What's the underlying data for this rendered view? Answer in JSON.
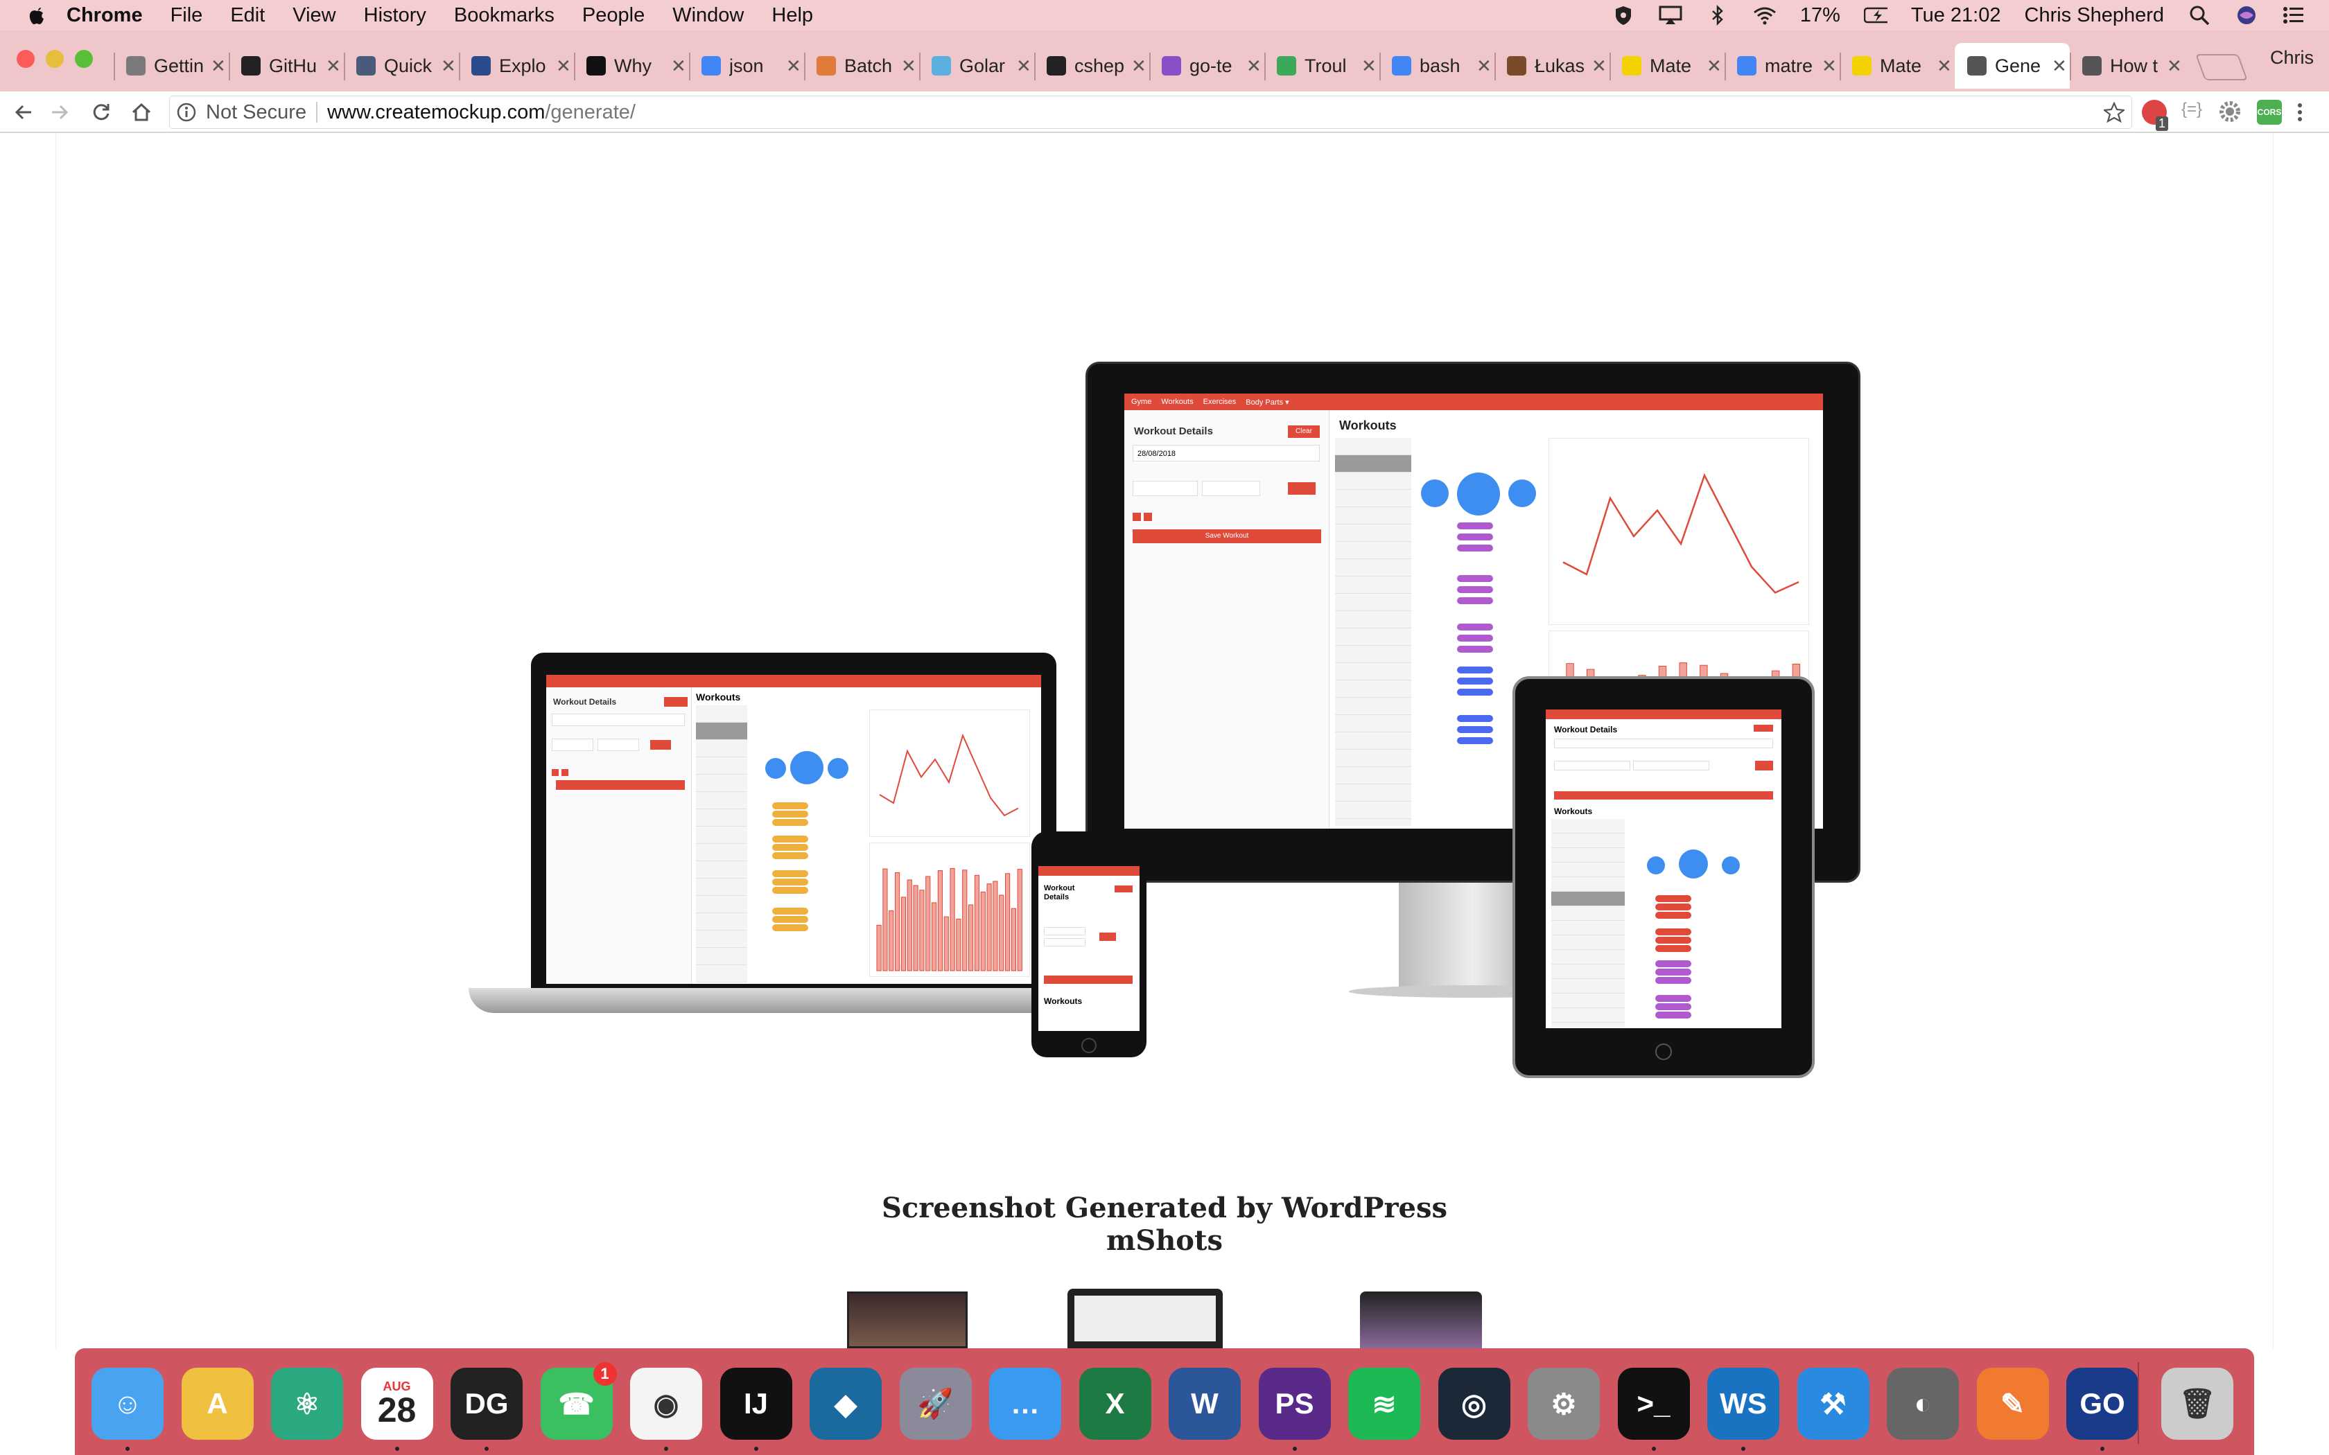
{
  "menubar": {
    "app": "Chrome",
    "items": [
      "File",
      "Edit",
      "View",
      "History",
      "Bookmarks",
      "People",
      "Window",
      "Help"
    ],
    "battery": "17%",
    "clock": "Tue 21:02",
    "user": "Chris Shepherd"
  },
  "tabs": [
    {
      "title": "Gettin",
      "color": "#7a7a7a"
    },
    {
      "title": "GitHu",
      "color": "#222"
    },
    {
      "title": "Quick",
      "color": "#4a5a7a"
    },
    {
      "title": "Explo",
      "color": "#2b4b8c"
    },
    {
      "title": "Why",
      "color": "#111"
    },
    {
      "title": "json",
      "color": "#4285f4"
    },
    {
      "title": "Batch",
      "color": "#e07b39"
    },
    {
      "title": "Golar",
      "color": "#5bb0e0"
    },
    {
      "title": "cshep",
      "color": "#222"
    },
    {
      "title": "go-te",
      "color": "#8a4fc7"
    },
    {
      "title": "Troul",
      "color": "#3aaa5a"
    },
    {
      "title": "bash",
      "color": "#4285f4"
    },
    {
      "title": "Łukas",
      "color": "#7a4a2a"
    },
    {
      "title": "Mate",
      "color": "#f2d200"
    },
    {
      "title": "matre",
      "color": "#4285f4"
    },
    {
      "title": "Mate",
      "color": "#f2d200"
    },
    {
      "title": "Gene",
      "color": "#555"
    },
    {
      "title": "How t",
      "color": "#555"
    }
  ],
  "active_tab": 16,
  "profile": "Chris",
  "address": {
    "security": "Not Secure",
    "host": "www.createmockup.com",
    "path": "/generate/"
  },
  "page": {
    "heading": "Screenshot Generated by WordPress mShots"
  },
  "mock": {
    "brand": "Gyme",
    "nav": [
      "Workouts",
      "Exercises",
      "Body Parts ▾"
    ],
    "details": "Workout Details",
    "clear": "Clear",
    "date": "28/08/2018",
    "save": "Save Workout",
    "workouts": "Workouts"
  },
  "badge": {
    "chrome": "1",
    "facetime": "1"
  },
  "calendar": {
    "month": "AUG",
    "day": "28"
  },
  "dock": [
    "Finder",
    "Android Studio",
    "Atom",
    "Calendar",
    "DataGrip",
    "FaceTime",
    "Chrome",
    "IntelliJ IDEA",
    "Kodi",
    "Launchpad",
    "Messages",
    "Excel",
    "Word",
    "PhpStorm",
    "Spotify",
    "Steam",
    "System Preferences",
    "Terminal",
    "WebStorm",
    "Xcode",
    "Sequel Pro",
    "Postman",
    "GoLand",
    "Trash"
  ],
  "colors": {
    "accent": "#e04a3a",
    "menubar": "#f3cdd0",
    "dock": "#cf5660"
  }
}
